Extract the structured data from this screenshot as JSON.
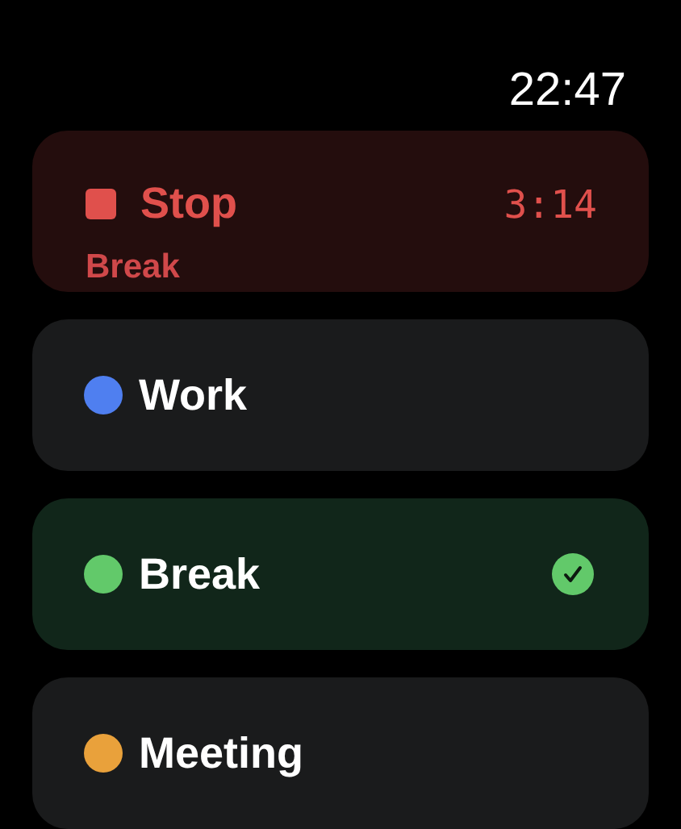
{
  "status_bar": {
    "time": "22:47"
  },
  "timer": {
    "action": "Stop",
    "elapsed": "3:14",
    "activity": "Break"
  },
  "activities": [
    {
      "name": "Work",
      "color": "#4f7ff0",
      "selected": false
    },
    {
      "name": "Break",
      "color": "#62c96a",
      "selected": true
    },
    {
      "name": "Meeting",
      "color": "#e9a13b",
      "selected": false
    }
  ]
}
